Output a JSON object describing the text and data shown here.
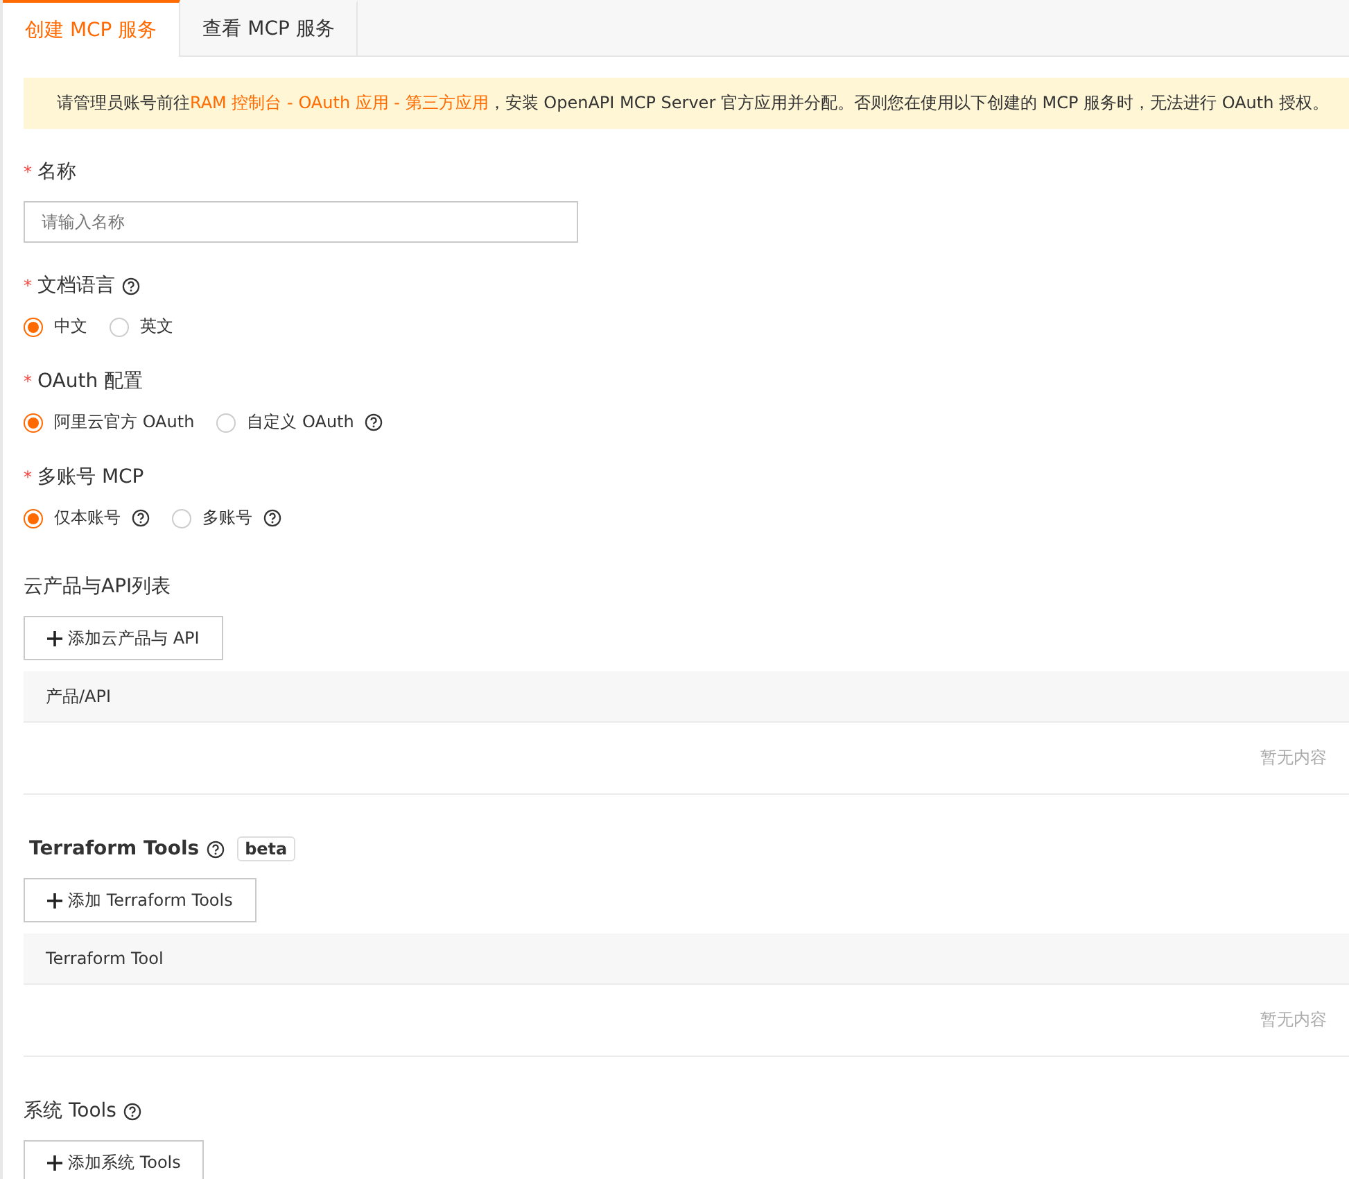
{
  "tabs": [
    {
      "label": "创建 MCP 服务",
      "selected": true
    },
    {
      "label": "查看 MCP 服务",
      "selected": false
    }
  ],
  "alert": {
    "before": "请管理员账号前往",
    "link": "RAM 控制台 - OAuth 应用 - 第三方应用",
    "after": "，安装 OpenAPI MCP Server 官方应用并分配。否则您在使用以下创建的 MCP 服务时，无法进行 OAuth 授权。"
  },
  "fields": [
    {
      "kind": "input",
      "mark": "*",
      "label": "名称",
      "placeholder": "请输入名称"
    },
    {
      "kind": "radio",
      "mark": "*",
      "label": "文档语言",
      "help": true,
      "options": [
        {
          "label": "中文",
          "selected": true
        },
        {
          "label": "英文",
          "selected": false
        }
      ]
    },
    {
      "kind": "radio",
      "mark": "*",
      "label": "OAuth 配置",
      "options": [
        {
          "label": "阿里云官方 OAuth",
          "selected": true
        },
        {
          "label": "自定义 OAuth",
          "selected": false,
          "help": true
        }
      ]
    },
    {
      "kind": "radio",
      "mark": "*",
      "label": "多账号 MCP",
      "options": [
        {
          "label": "仅本账号",
          "selected": true,
          "help": true
        },
        {
          "label": "多账号",
          "selected": false,
          "help": true
        }
      ]
    }
  ],
  "sections": [
    {
      "title": "云产品与API列表",
      "button": "添加云产品与 API",
      "table": {
        "column": "产品/API",
        "empty": "暂无内容"
      }
    },
    {
      "title": "Terraform Tools",
      "bold": true,
      "help": true,
      "badge": "beta",
      "button": "添加 Terraform Tools",
      "table": {
        "column": "Terraform Tool",
        "empty": "暂无内容"
      }
    },
    {
      "title": "系统 Tools",
      "help": true,
      "button": "添加系统 Tools"
    }
  ]
}
